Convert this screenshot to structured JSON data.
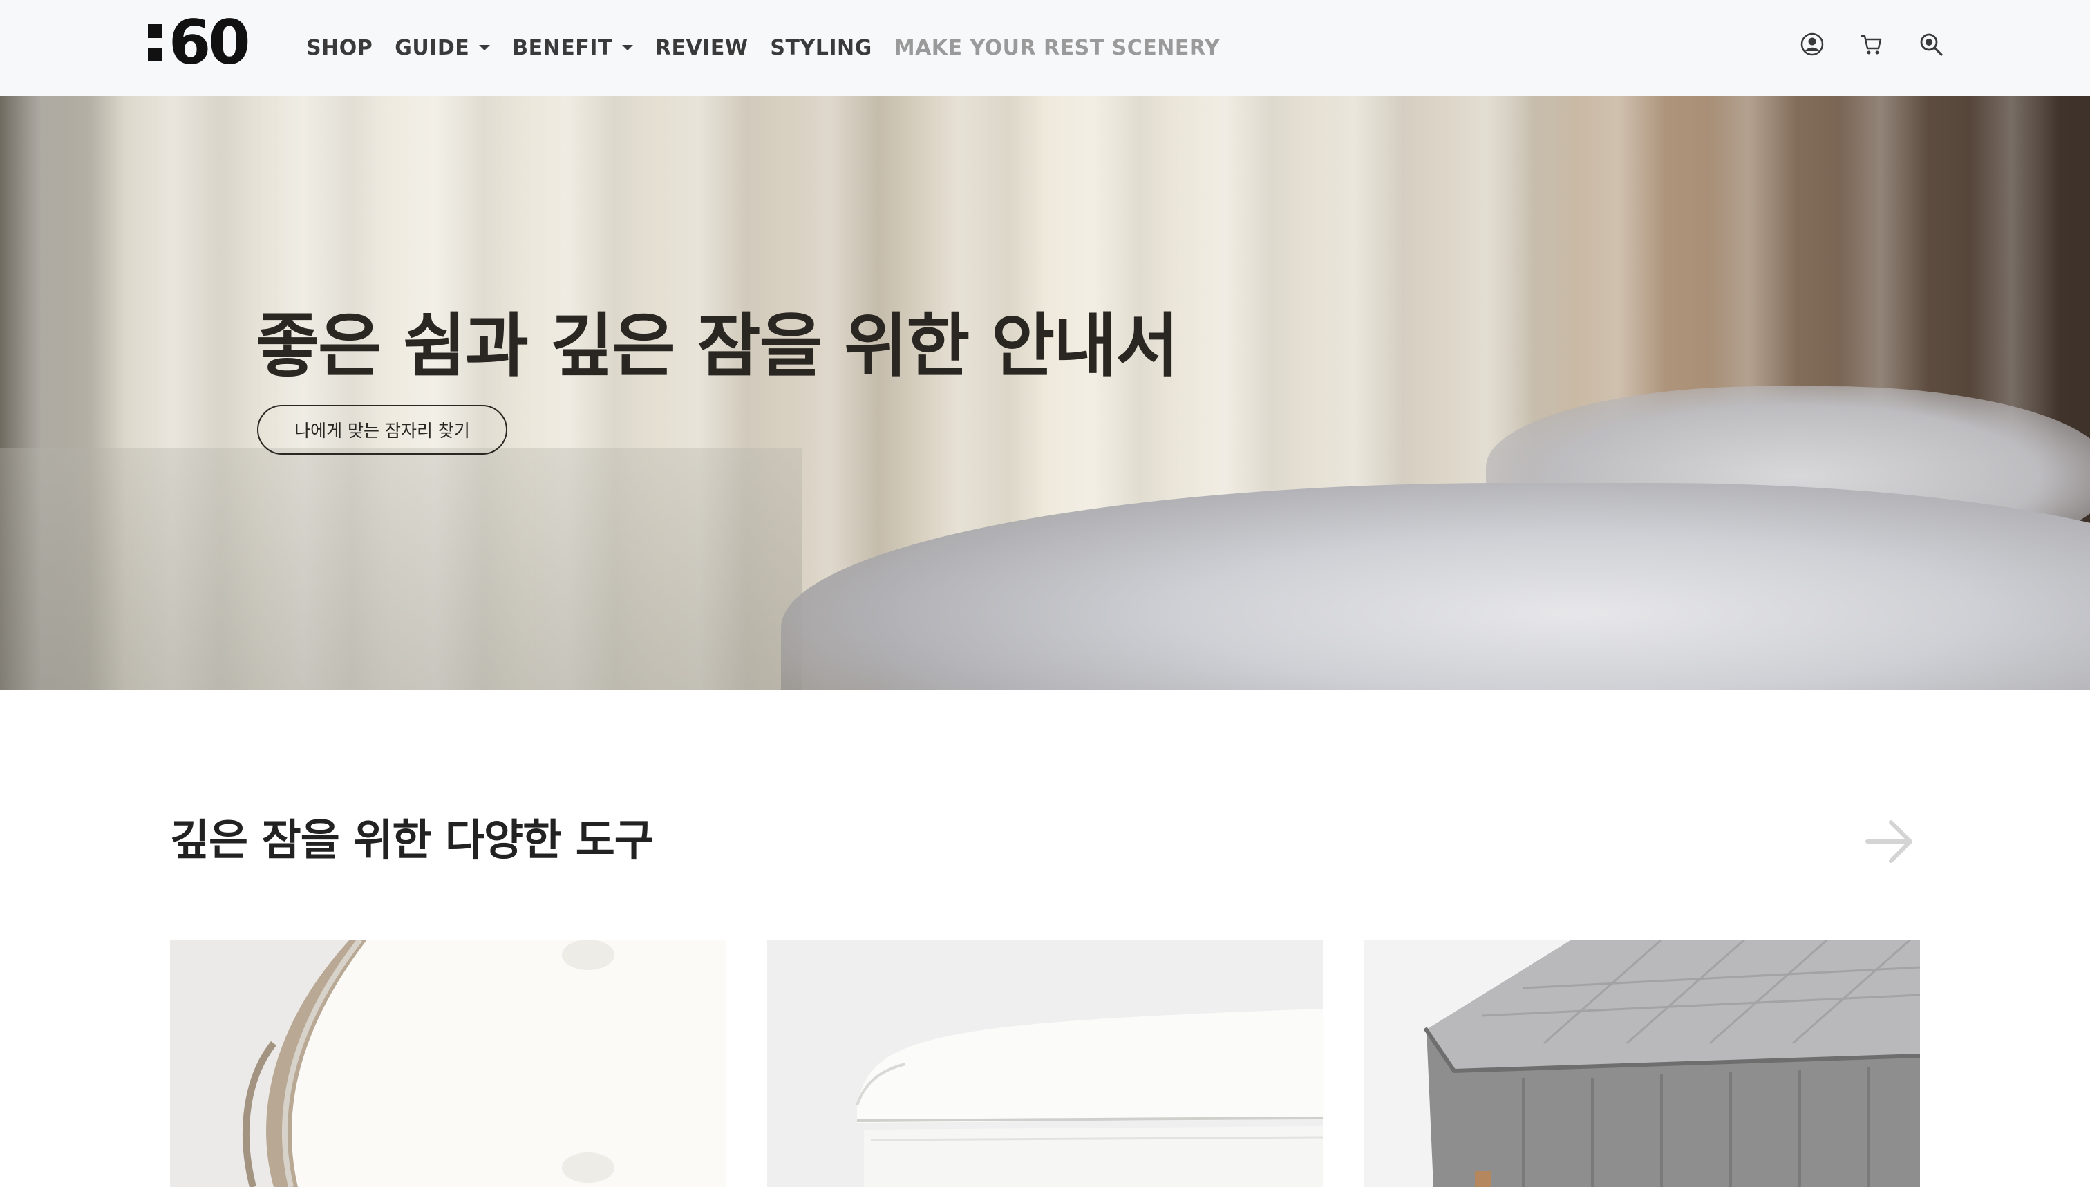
{
  "header": {
    "logo_text": "60",
    "nav": [
      {
        "label": "SHOP",
        "has_dropdown": false
      },
      {
        "label": "GUIDE",
        "has_dropdown": true
      },
      {
        "label": "BENEFIT",
        "has_dropdown": true
      },
      {
        "label": "REVIEW",
        "has_dropdown": false
      },
      {
        "label": "STYLING",
        "has_dropdown": false
      },
      {
        "label": "MAKE YOUR REST SCENERY",
        "has_dropdown": false
      }
    ],
    "icons": [
      "account-icon",
      "cart-icon",
      "search-icon"
    ]
  },
  "hero": {
    "title": "좋은 쉼과 깊은 잠을 위한 안내서",
    "button_label": "나에게 맞는 잠자리 찾기"
  },
  "section": {
    "title": "깊은 잠을 위한 다양한 도구",
    "arrow_icon": "arrow-right-icon"
  },
  "products": [
    {
      "image": "mattress-topper-image"
    },
    {
      "image": "pillow-image"
    },
    {
      "image": "mattress-image"
    }
  ],
  "colors": {
    "header_bg": "#f7f8fa",
    "nav_text": "#3a3a3a",
    "nav_muted": "#9a9a9a",
    "hero_text": "#2a2723"
  }
}
